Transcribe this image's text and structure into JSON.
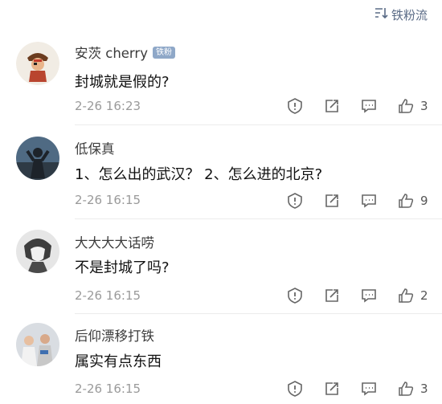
{
  "sort": {
    "label": "铁粉流",
    "icon": "sort-icon"
  },
  "comments": [
    {
      "user": "安茨 cherry",
      "badge": "铁粉",
      "text": "封城就是假的?",
      "time": "2-26 16:23",
      "likes": "3",
      "avatar": "avatar-pirate-cartoon"
    },
    {
      "user": "低保真",
      "text": "1、怎么出的武汉？  2、怎么进的北京?",
      "time": "2-26 16:15",
      "likes": "9",
      "avatar": "avatar-person-photo"
    },
    {
      "user": "大大大大话唠",
      "text": "不是封城了吗?",
      "time": "2-26 16:15",
      "likes": "2",
      "avatar": "avatar-anime-gray"
    },
    {
      "user": "后仰漂移打铁",
      "text": "属实有点东西",
      "time": "2-26 16:15",
      "likes": "3",
      "avatar": "avatar-people-photo"
    }
  ],
  "action_icons": [
    "report-icon",
    "repost-icon",
    "comment-icon",
    "like-icon"
  ]
}
